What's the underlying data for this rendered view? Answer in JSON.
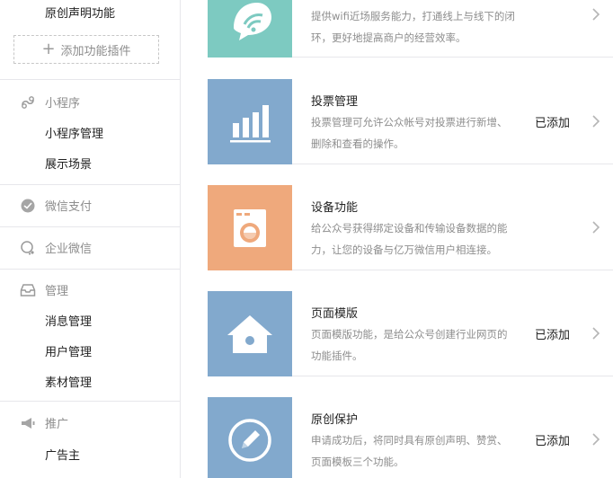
{
  "sidebar": {
    "original_decl": "原创声明功能",
    "add_plugin": "添加功能插件",
    "miniprogram": {
      "title": "小程序",
      "items": [
        "小程序管理",
        "展示场景"
      ]
    },
    "wechat_pay": "微信支付",
    "enterprise_wechat": "企业微信",
    "manage": {
      "title": "管理",
      "items": [
        "消息管理",
        "用户管理",
        "素材管理"
      ]
    },
    "promote": {
      "title": "推广",
      "items": [
        "广告主"
      ]
    }
  },
  "plugins": [
    {
      "title": "",
      "desc1": "提供wifi近场服务能力，打通线上与线下的闭",
      "desc2": "环，更好地提高商户的经营效率。",
      "status": "",
      "color": "#7dcac1",
      "icon": "wifi-chat-icon"
    },
    {
      "title": "投票管理",
      "desc1": "投票管理可允许公众帐号对投票进行新增、",
      "desc2": "删除和查看的操作。",
      "status": "已添加",
      "color": "#82a9cd",
      "icon": "bar-chart-icon"
    },
    {
      "title": "设备功能",
      "desc1": "给公众号获得绑定设备和传输设备数据的能",
      "desc2": "力，让您的设备与亿万微信用户相连接。",
      "status": "",
      "color": "#efa97c",
      "icon": "washing-machine-icon"
    },
    {
      "title": "页面模版",
      "desc1": "页面模版功能，是给公众号创建行业网页的",
      "desc2": "功能插件。",
      "status": "已添加",
      "color": "#82a9cd",
      "icon": "house-icon"
    },
    {
      "title": "原创保护",
      "desc1": "申请成功后，将同时具有原创声明、赞赏、",
      "desc2": "页面模板三个功能。",
      "status": "已添加",
      "color": "#82a9cd",
      "icon": "pencil-circle-icon"
    }
  ]
}
